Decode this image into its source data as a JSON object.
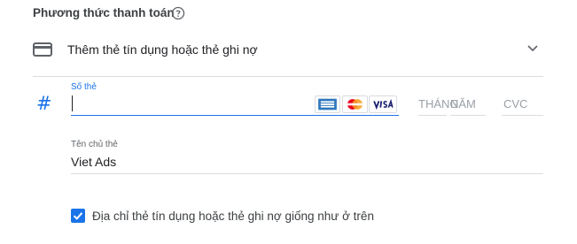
{
  "header": {
    "title": "Phương thức thanh toán",
    "help_icon": "help-circle-icon"
  },
  "payment_method": {
    "label": "Thêm thẻ tín dụng hoặc thẻ ghi nợ",
    "icon": "credit-card-icon",
    "expand_icon": "chevron-down-icon"
  },
  "card_number": {
    "label": "Số thẻ",
    "value": "",
    "prefix_icon": "hash-icon",
    "prefix_glyph": "#"
  },
  "card_brands": [
    "amex",
    "mastercard",
    "visa"
  ],
  "expiry": {
    "month_placeholder": "THÁNG",
    "year_placeholder": "NĂM"
  },
  "cvc": {
    "placeholder": "CVC"
  },
  "cardholder": {
    "label": "Tên chủ thẻ",
    "value": "Viet Ads"
  },
  "billing_same": {
    "label": "Địa chỉ thẻ tín dụng hoặc thẻ ghi nợ giống như ở trên",
    "checked": true
  },
  "colors": {
    "accent": "#1a73e8",
    "divider": "#dadce0",
    "amex": "#2e77bc",
    "mastercard_red": "#eb001b",
    "mastercard_orange": "#f79e1b",
    "visa": "#1a1f71"
  }
}
